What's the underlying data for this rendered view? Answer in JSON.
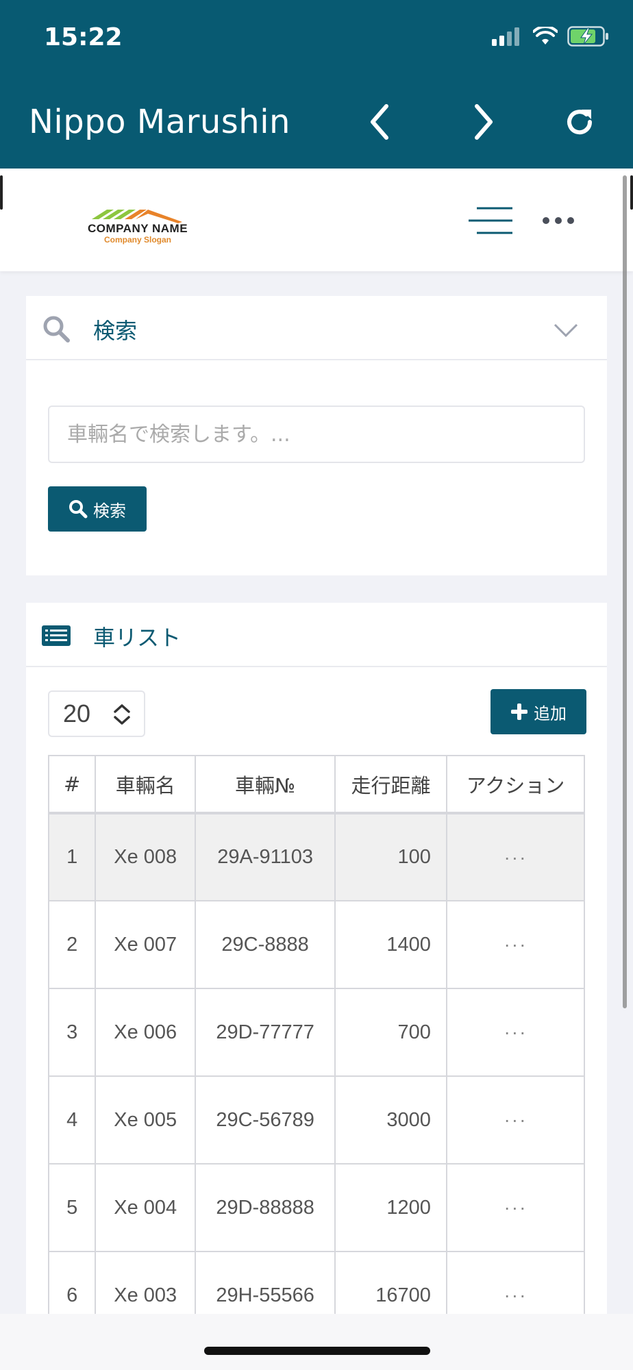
{
  "status_bar": {
    "time": "15:22"
  },
  "app_bar": {
    "title": "Nippo Marushin"
  },
  "header": {
    "logo_name": "COMPANY NAME",
    "logo_slogan": "Company Slogan",
    "colors": {
      "roof_orange": "#e8832a",
      "roof_green": "#8dc63f"
    }
  },
  "search_card": {
    "title": "検索",
    "input_placeholder": "車輛名で検索します。...",
    "button_label": "検索"
  },
  "list_card": {
    "title": "車リスト",
    "page_size": "20",
    "add_button_label": "追加",
    "columns": [
      "#",
      "車輛名",
      "車輛№",
      "走行距離",
      "アクション"
    ],
    "rows": [
      {
        "index": "1",
        "name": "Xe 008",
        "plate": "29A-91103",
        "distance": "100",
        "action": "···"
      },
      {
        "index": "2",
        "name": "Xe 007",
        "plate": "29C-8888",
        "distance": "1400",
        "action": "···"
      },
      {
        "index": "3",
        "name": "Xe 006",
        "plate": "29D-77777",
        "distance": "700",
        "action": "···"
      },
      {
        "index": "4",
        "name": "Xe 005",
        "plate": "29C-56789",
        "distance": "3000",
        "action": "···"
      },
      {
        "index": "5",
        "name": "Xe 004",
        "plate": "29D-88888",
        "distance": "1200",
        "action": "···"
      },
      {
        "index": "6",
        "name": "Xe 003",
        "plate": "29H-55566",
        "distance": "16700",
        "action": "···"
      }
    ]
  },
  "theme": {
    "primary": "#085a72",
    "background": "#f1f2f7"
  }
}
